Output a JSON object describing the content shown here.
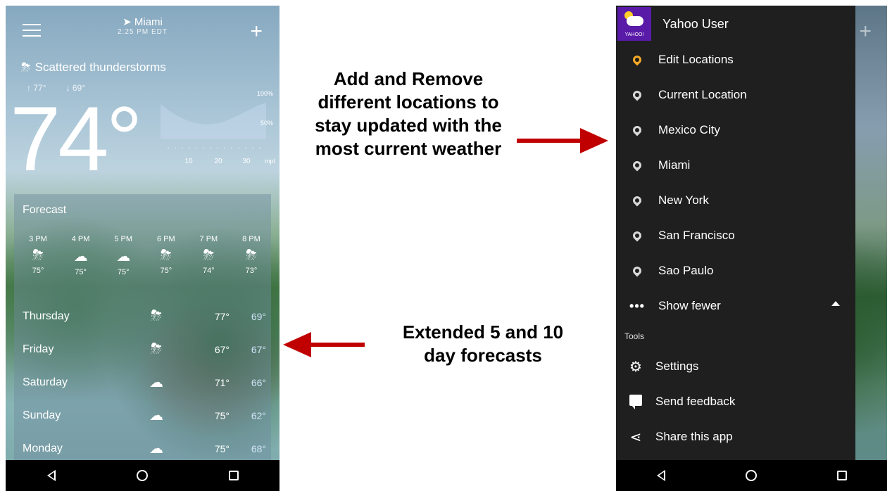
{
  "left_phone": {
    "location": "Miami",
    "local_time": "2:25 PM EDT",
    "condition": "Scattered thunderstorms",
    "high": "77°",
    "low": "69°",
    "current_temp": "74°",
    "precip_axis": {
      "right_labels": [
        "100%",
        "50%"
      ],
      "bottom_labels": [
        "10",
        "20",
        "30"
      ],
      "unit": "mph"
    },
    "forecast_title": "Forecast",
    "hourly": [
      {
        "time": "3 PM",
        "icon": "thunderstorm-icon",
        "temp": "75°"
      },
      {
        "time": "4 PM",
        "icon": "cloud-icon",
        "temp": "75°"
      },
      {
        "time": "5 PM",
        "icon": "cloud-icon",
        "temp": "75°"
      },
      {
        "time": "6 PM",
        "icon": "thunderstorm-icon",
        "temp": "75°"
      },
      {
        "time": "7 PM",
        "icon": "thunderstorm-icon",
        "temp": "74°"
      },
      {
        "time": "8 PM",
        "icon": "thunderstorm-icon",
        "temp": "73°"
      }
    ],
    "daily": [
      {
        "day": "Thursday",
        "icon": "thunderstorm-icon",
        "high": "77°",
        "low": "69°"
      },
      {
        "day": "Friday",
        "icon": "thunderstorm-icon",
        "high": "67°",
        "low": "67°"
      },
      {
        "day": "Saturday",
        "icon": "cloud-icon",
        "high": "71°",
        "low": "66°"
      },
      {
        "day": "Sunday",
        "icon": "cloud-icon",
        "high": "75°",
        "low": "62°"
      },
      {
        "day": "Monday",
        "icon": "cloud-icon",
        "high": "75°",
        "low": "68°"
      }
    ]
  },
  "captions": {
    "top": "Add and Remove different locations to stay updated with the most current weather",
    "bottom": "Extended 5 and 10 day forecasts"
  },
  "right_phone": {
    "logo_text": "YAHOO!",
    "user_name": "Yahoo User",
    "edit_locations": "Edit Locations",
    "locations": [
      "Current Location",
      "Mexico City",
      "Miami",
      "New York",
      "San Francisco",
      "Sao Paulo"
    ],
    "show_fewer": "Show fewer",
    "tools_label": "Tools",
    "tools": [
      {
        "label": "Settings",
        "icon": "settings-icon"
      },
      {
        "label": "Send feedback",
        "icon": "feedback-icon"
      },
      {
        "label": "Share this app",
        "icon": "share-icon"
      }
    ]
  },
  "colors": {
    "arrow": "#c00000",
    "drawer_bg": "#1f1f1f",
    "active_pin": "#f3a826",
    "yahoo_purple": "#5a1aa8"
  }
}
